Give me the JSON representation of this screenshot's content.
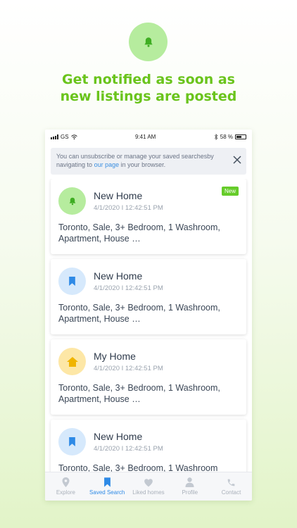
{
  "hero": {
    "icon": "bell-icon",
    "line1": "Get notified as soon as",
    "line2": "new listings are posted",
    "accent": "#6ac41c"
  },
  "statusbar": {
    "carrier": "GS",
    "time": "9:41 AM",
    "battery": "58 %"
  },
  "notice": {
    "text_before": "You can unsubscribe or manage your saved searchesby navigating to",
    "link": "our page",
    "text_after": "in your browser."
  },
  "cards": [
    {
      "icon": "bell-icon",
      "title": "New Home",
      "date": "4/1/2020 I 12:42:51 PM",
      "desc": "Toronto, Sale, 3+ Bedroom, 1 Washroom, Apartment, House …",
      "badge": "New"
    },
    {
      "icon": "bookmark-icon",
      "title": "New Home",
      "date": "4/1/2020 I 12:42:51 PM",
      "desc": "Toronto, Sale, 3+ Bedroom, 1 Washroom, Apartment, House …"
    },
    {
      "icon": "home-icon",
      "title": "My Home",
      "date": "4/1/2020 I 12:42:51 PM",
      "desc": "Toronto, Sale, 3+ Bedroom, 1 Washroom, Apartment, House …"
    },
    {
      "icon": "bookmark-icon",
      "title": "New Home",
      "date": "4/1/2020 I 12:42:51 PM",
      "desc": "Toronto, Sale, 3+ Bedroom, 1 Washroom"
    }
  ],
  "tabs": [
    {
      "label": "Explore",
      "icon": "map-pin-icon"
    },
    {
      "label": "Saved Search",
      "icon": "bookmark-icon",
      "active": true
    },
    {
      "label": "Liked homes",
      "icon": "heart-icon"
    },
    {
      "label": "Profile",
      "icon": "person-icon"
    },
    {
      "label": "Contact",
      "icon": "phone-icon"
    }
  ],
  "colors": {
    "green_accent": "#66cc2a",
    "blue_accent": "#2e8ae6",
    "amber_accent": "#f0b400"
  }
}
